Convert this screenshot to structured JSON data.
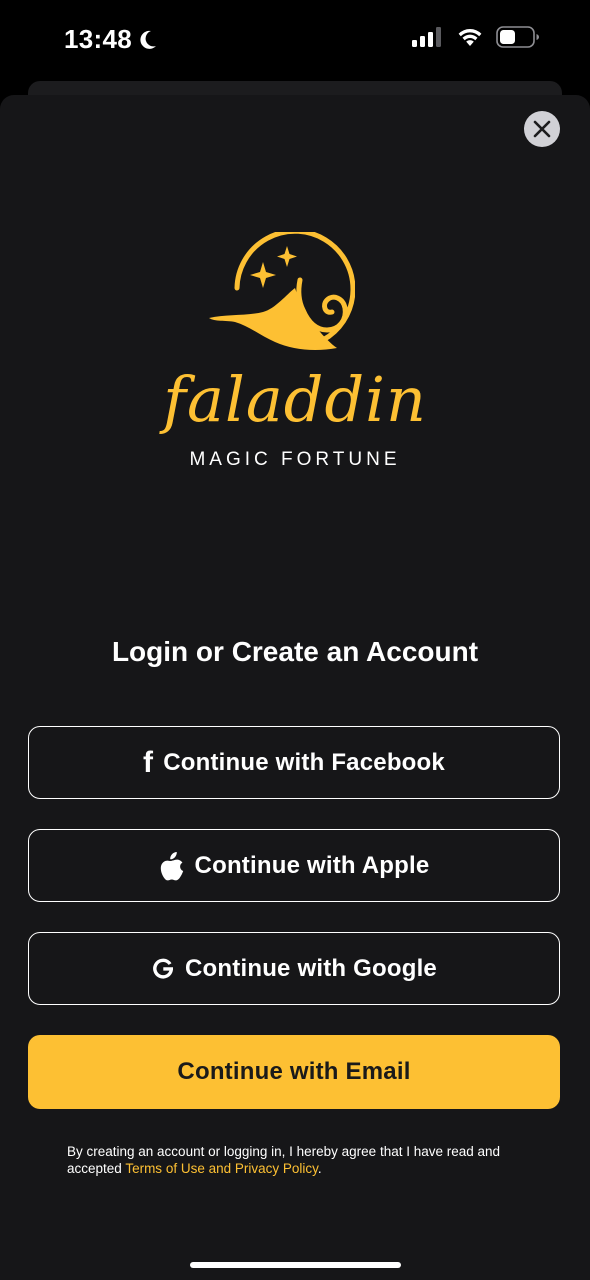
{
  "status_bar": {
    "time": "13:48"
  },
  "brand": {
    "name": "faladdin",
    "tagline": "MAGIC FORTUNE"
  },
  "page": {
    "title": "Login or Create an Account"
  },
  "buttons": {
    "facebook": "Continue with Facebook",
    "apple": "Continue with Apple",
    "google": "Continue with Google",
    "email": "Continue with Email"
  },
  "legal": {
    "text": "By creating an account or logging in, I hereby agree that I have read and accepted ",
    "link": "Terms of Use and Privacy Policy",
    "suffix": "."
  },
  "colors": {
    "accent": "#fdc033",
    "background": "#161618"
  },
  "icons": {
    "close": "close-icon",
    "facebook": "facebook-icon",
    "apple": "apple-icon",
    "google": "google-icon"
  }
}
